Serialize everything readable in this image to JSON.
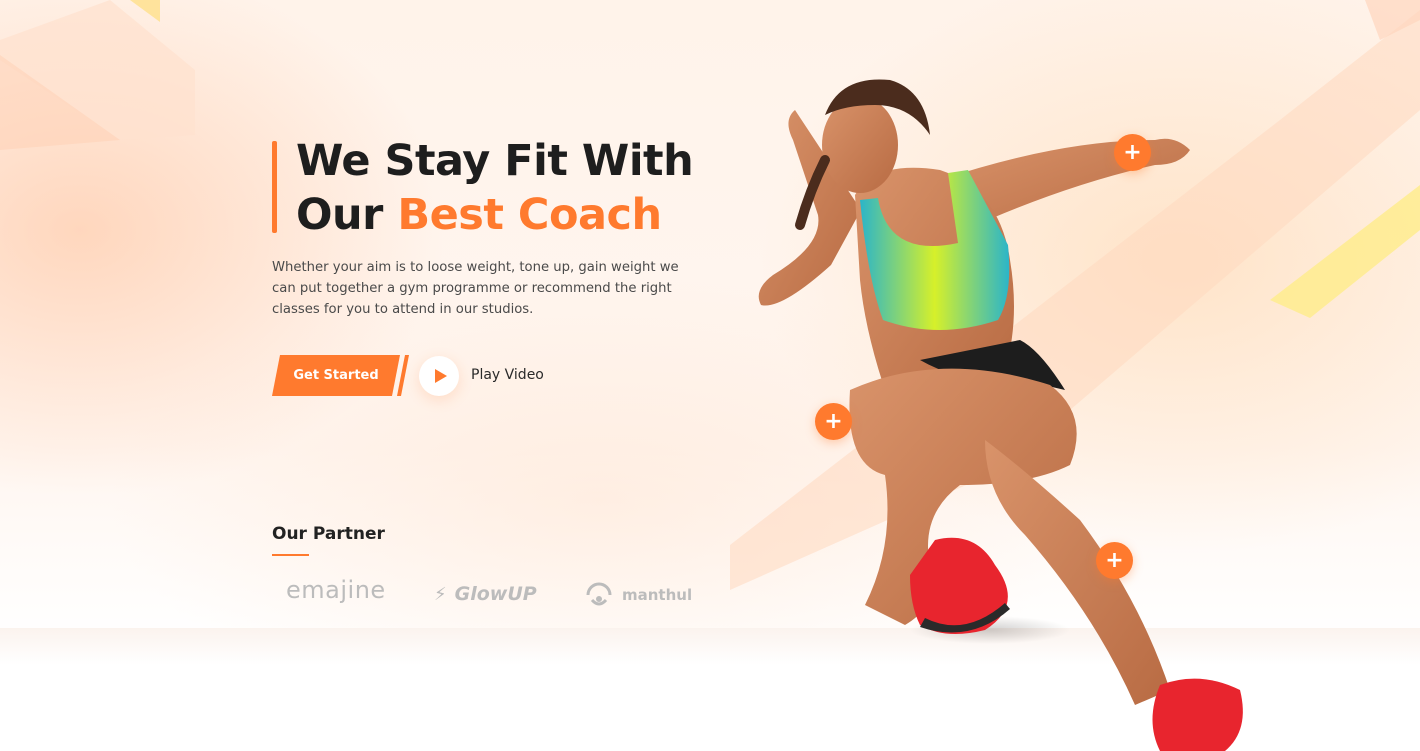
{
  "hero": {
    "title_line1": "We Stay Fit With",
    "title_line2_plain": "Our ",
    "title_line2_accent": "Best Coach",
    "description": "Whether your aim is to loose weight, tone up, gain weight we can put together a gym programme or recommend the right classes for you to attend in our studios."
  },
  "cta": {
    "primary_label": "Get Started",
    "video_label": "Play Video"
  },
  "partners": {
    "title": "Our Partner",
    "logos": [
      {
        "name": "emajine",
        "icon": "emajine-logo"
      },
      {
        "name": "GlowUP",
        "icon": "bolt-icon"
      },
      {
        "name": "manthul",
        "icon": "manthul-mark-icon"
      }
    ]
  },
  "hotspots": [
    {
      "label": "+"
    },
    {
      "label": "+"
    },
    {
      "label": "+"
    }
  ],
  "colors": {
    "accent": "#ff7a2e",
    "heading": "#1e1e1e",
    "body_text": "#4a4a4a",
    "logo_gray": "#bcbcbc",
    "top_neon": "#2bb5c9",
    "top_lime": "#d6f02a",
    "shoe_red": "#e8252e"
  }
}
